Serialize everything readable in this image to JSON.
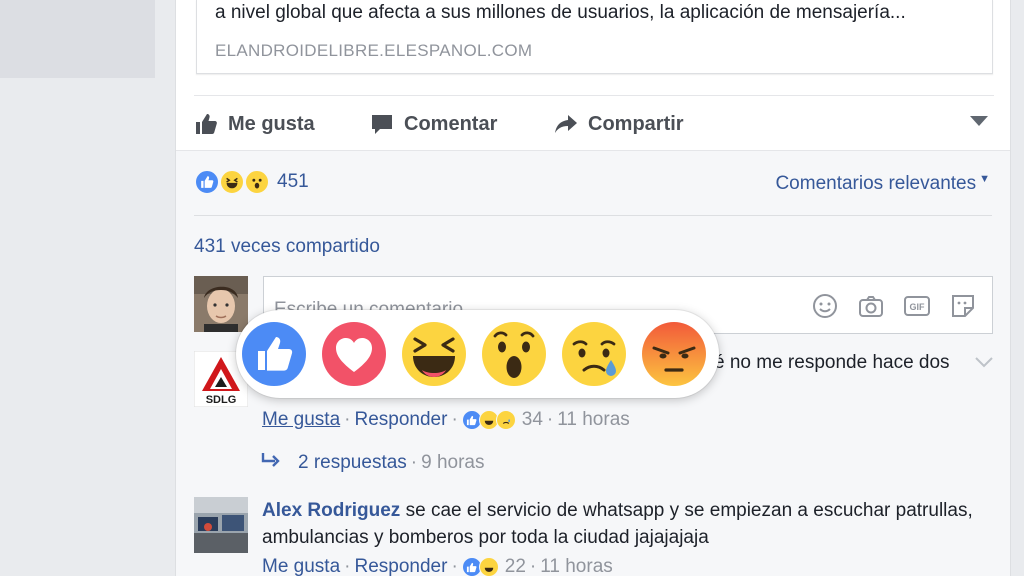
{
  "link_card": {
    "description": "a nivel global que afecta a sus millones de usuarios, la aplicación de mensajería...",
    "domain": "ELANDROIDELIBRE.ELESPANOL.COM"
  },
  "actions": {
    "like_label": "Me gusta",
    "comment_label": "Comentar",
    "share_label": "Compartir"
  },
  "reactions_summary": {
    "count": "451",
    "icons": [
      "like-icon",
      "haha-icon",
      "wow-icon"
    ]
  },
  "sort_label": "Comentarios relevantes",
  "shares_label": "431 veces compartido",
  "composer": {
    "placeholder": "Escribe un comentario...",
    "tools": [
      "emoji-icon",
      "camera-icon",
      "gif-icon",
      "sticker-icon"
    ]
  },
  "reaction_picker": [
    "like",
    "love",
    "haha",
    "wow",
    "sad",
    "angry"
  ],
  "comments": [
    {
      "author": "",
      "text_visible": "é no me responde hace dos",
      "like_label": "Me gusta",
      "reply_label": "Responder",
      "reaction_count": "34",
      "time": "11 horas",
      "replies_label": "2 respuestas",
      "replies_time": "9 horas",
      "avatar_text": "SDLG"
    },
    {
      "author": "Alex Rodriguez",
      "text": "se cae el servicio de whatsapp y se empiezan a escuchar patrullas, ambulancias y bomberos por toda la ciudad jajajajaja",
      "like_label": "Me gusta",
      "reply_label": "Responder",
      "reaction_count": "22",
      "time": "11 horas"
    }
  ],
  "colors": {
    "link_blue": "#365899",
    "fb_blue": "#4267b2",
    "grey_text": "#90949c",
    "like_blue": "#4c8bf5",
    "love_red": "#f25268",
    "emoji_yellow": "#fcd440",
    "angry_red": "#f26b3a"
  }
}
